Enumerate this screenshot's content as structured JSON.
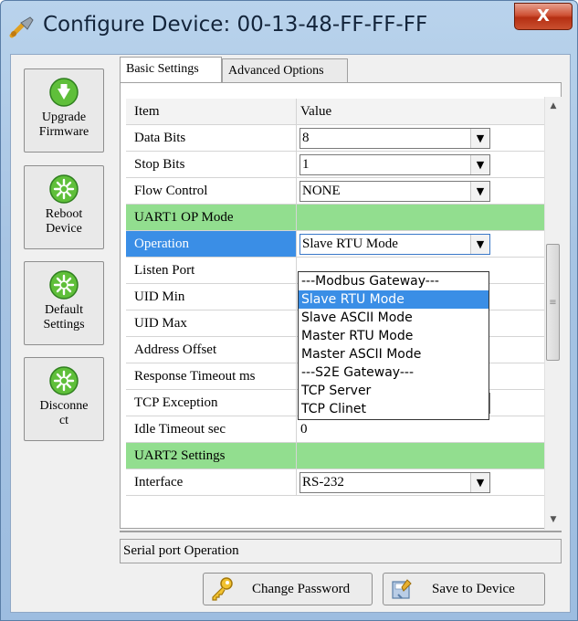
{
  "window": {
    "title": "Configure Device: 00-13-48-FF-FF-FF",
    "close_label": "X"
  },
  "sidebar": {
    "buttons": [
      {
        "label": "Upgrade Firmware",
        "line1": "Upgrade",
        "line2": "Firmware",
        "icon": "download-arrow-icon"
      },
      {
        "label": "Reboot Device",
        "line1": "Reboot",
        "line2": "Device",
        "icon": "gear-burst-icon"
      },
      {
        "label": "Default Settings",
        "line1": "Default",
        "line2": "Settings",
        "icon": "gear-burst-icon"
      },
      {
        "label": "Disconnect",
        "line1": "Disconne",
        "line2": "ct",
        "icon": "gear-burst-icon"
      }
    ]
  },
  "tabs": [
    {
      "label": "Basic Settings",
      "active": true
    },
    {
      "label": "Advanced Options",
      "active": false
    }
  ],
  "grid": {
    "headers": {
      "item": "Item",
      "value": "Value"
    },
    "rows": [
      {
        "item": "Data Bits",
        "value": "8",
        "type": "combo"
      },
      {
        "item": "Stop Bits",
        "value": "1",
        "type": "combo"
      },
      {
        "item": "Flow Control",
        "value": "NONE",
        "type": "combo"
      },
      {
        "item": "UART1 OP Mode",
        "value": "",
        "type": "section"
      },
      {
        "item": "Operation",
        "value": "Slave RTU Mode",
        "type": "combo-selected"
      },
      {
        "item": "Listen Port",
        "value": "",
        "type": "text"
      },
      {
        "item": "UID Min",
        "value": "",
        "type": "text"
      },
      {
        "item": "UID Max",
        "value": "",
        "type": "text"
      },
      {
        "item": "Address Offset",
        "value": "",
        "type": "text"
      },
      {
        "item": "Response Timeout ms",
        "value": "",
        "type": "text"
      },
      {
        "item": "TCP Exception",
        "value": "",
        "type": "combo-hidden"
      },
      {
        "item": "Idle Timeout sec",
        "value": "0",
        "type": "text"
      },
      {
        "item": "UART2 Settings",
        "value": "",
        "type": "section"
      },
      {
        "item": "Interface",
        "value": "RS-232",
        "type": "combo"
      }
    ]
  },
  "dropdown": {
    "options": [
      {
        "label": "---Modbus Gateway---",
        "selected": false
      },
      {
        "label": "Slave RTU Mode",
        "selected": true
      },
      {
        "label": "Slave ASCII Mode",
        "selected": false
      },
      {
        "label": "Master RTU Mode",
        "selected": false
      },
      {
        "label": "Master ASCII Mode",
        "selected": false
      },
      {
        "label": "---S2E Gateway---",
        "selected": false
      },
      {
        "label": "TCP Server",
        "selected": false
      },
      {
        "label": "TCP Clinet",
        "selected": false
      }
    ]
  },
  "status": {
    "description": "Serial port Operation"
  },
  "actions": {
    "change_password": {
      "label": "Change Password",
      "icon": "key-icon"
    },
    "save": {
      "label": "Save to Device",
      "icon": "save-device-icon"
    }
  },
  "colors": {
    "section_green": "#92de8f",
    "selection_blue": "#3a8ee6"
  }
}
